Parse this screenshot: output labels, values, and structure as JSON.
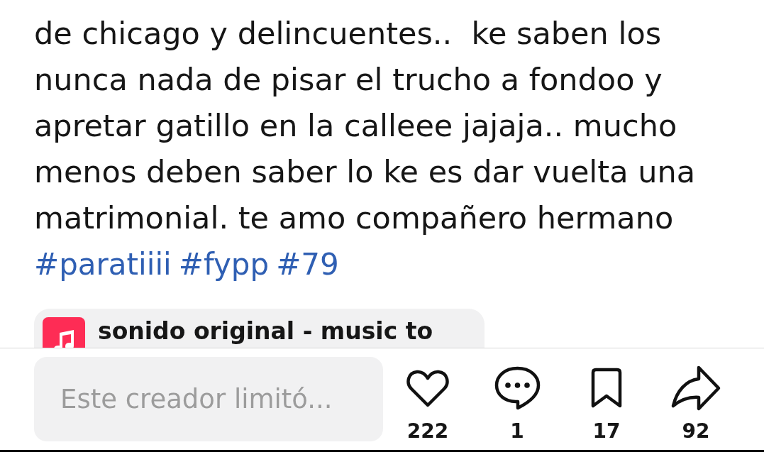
{
  "caption": {
    "text": "de chicago y delincuentes..  ke saben los nunca nada de pisar el trucho a fondoo y apretar gatillo en la calleee jajaja.. mucho menos deben saber lo ke es dar vuelta una matrimonial. te amo compañero hermano",
    "hashtags": [
      "#paratiiii",
      "#fypp",
      "#79"
    ]
  },
  "sound": {
    "title": "sonido original - music to"
  },
  "comment_box": {
    "placeholder": "Este creador limitó..."
  },
  "actions": [
    {
      "kind": "like",
      "count": "222"
    },
    {
      "kind": "comment",
      "count": "1"
    },
    {
      "kind": "save",
      "count": "17"
    },
    {
      "kind": "share",
      "count": "92"
    }
  ]
}
